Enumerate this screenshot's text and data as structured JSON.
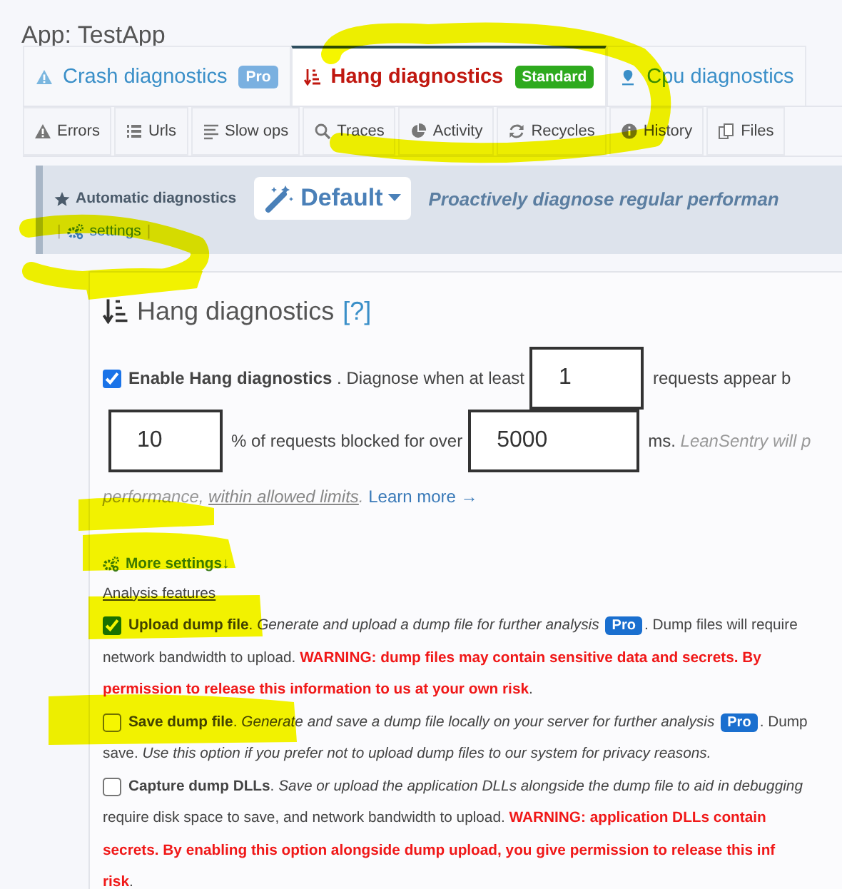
{
  "app_title": "App: TestApp",
  "tabs": [
    {
      "label": "Crash diagnostics",
      "badge": "Pro",
      "selected": false
    },
    {
      "label": "Hang diagnostics",
      "badge": "Standard",
      "selected": true
    },
    {
      "label": "Cpu diagnostics",
      "selected": false
    }
  ],
  "subtabs": [
    {
      "label": "Errors"
    },
    {
      "label": "Urls"
    },
    {
      "label": "Slow ops"
    },
    {
      "label": "Traces"
    },
    {
      "label": "Activity"
    },
    {
      "label": "Recycles"
    },
    {
      "label": "History"
    },
    {
      "label": "Files"
    }
  ],
  "automatic": {
    "label": "Automatic diagnostics",
    "profile": "Default",
    "description": "Proactively diagnose regular performan",
    "separator_left": "|",
    "settings_link": "settings",
    "separator_right": "|"
  },
  "panel": {
    "title": "Hang diagnostics",
    "help": "[?]",
    "lines": [
      [
        {
          "kind": "checkbox",
          "checked": true
        },
        {
          "kind": "bold",
          "text": "Enable Hang diagnostics"
        },
        {
          "kind": "text",
          "text": " . Diagnose when at least"
        },
        {
          "kind": "input",
          "value": "1"
        },
        {
          "kind": "text",
          "text": "requests appear b"
        }
      ],
      [
        {
          "kind": "input",
          "value": "10"
        },
        {
          "kind": "text",
          "text": "% of requests blocked for over"
        },
        {
          "kind": "input",
          "value": "5000"
        },
        {
          "kind": "text",
          "text": "ms. "
        },
        {
          "kind": "muted",
          "text": "LeanSentry will p"
        }
      ],
      [
        {
          "kind": "muted",
          "text": "performance, "
        },
        {
          "kind": "muted_underline",
          "text": "within allowed limits"
        },
        {
          "kind": "muted",
          "text": ". "
        },
        {
          "kind": "link",
          "text": "Learn more →"
        }
      ],
      [
        {
          "kind": "more",
          "text": "More settings"
        },
        {
          "kind": "arrow",
          "text": "↓"
        }
      ],
      [
        {
          "kind": "underline",
          "text": "Analysis features"
        }
      ],
      [
        {
          "kind": "checkbox",
          "checked": true
        },
        {
          "kind": "bold",
          "text": "Upload dump file"
        },
        {
          "kind": "text",
          "text": ". "
        },
        {
          "kind": "italic",
          "text": "Generate and upload a dump file for further analysis"
        },
        {
          "kind": "badge",
          "text": "Pro"
        },
        {
          "kind": "text",
          "text": ". Dump files will require"
        }
      ],
      [
        {
          "kind": "text",
          "text": "network bandwidth to upload. "
        },
        {
          "kind": "warning",
          "text": "WARNING: dump files may contain sensitive data and secrets. By"
        }
      ],
      [
        {
          "kind": "warning",
          "text": "permission to release this information to us at your own risk"
        },
        {
          "kind": "text",
          "text": "."
        }
      ],
      [
        {
          "kind": "checkbox",
          "checked": false
        },
        {
          "kind": "bold",
          "text": "Save dump file"
        },
        {
          "kind": "text",
          "text": ". "
        },
        {
          "kind": "italic",
          "text": "Generate and save a dump file locally on your server for further analysis"
        },
        {
          "kind": "badge",
          "text": "Pro"
        },
        {
          "kind": "text",
          "text": ". Dump"
        }
      ],
      [
        {
          "kind": "text",
          "text": "save. "
        },
        {
          "kind": "italic",
          "text": "Use this option if you prefer not to upload dump files to our system for privacy reasons."
        }
      ],
      [
        {
          "kind": "checkbox",
          "checked": false
        },
        {
          "kind": "bold",
          "text": "Capture dump DLLs"
        },
        {
          "kind": "text",
          "text": ". "
        },
        {
          "kind": "italic",
          "text": "Save or upload the application DLLs alongside the dump file to aid in debugging"
        }
      ],
      [
        {
          "kind": "text",
          "text": "require disk space to save, and network bandwidth to upload. "
        },
        {
          "kind": "warning",
          "text": "WARNING: application DLLs contain"
        }
      ],
      [
        {
          "kind": "warning",
          "text": "secrets. By enabling this option alongside dump upload, you give permission to release this inf"
        }
      ],
      [
        {
          "kind": "warning",
          "text": "risk"
        },
        {
          "kind": "text",
          "text": "."
        }
      ]
    ]
  }
}
